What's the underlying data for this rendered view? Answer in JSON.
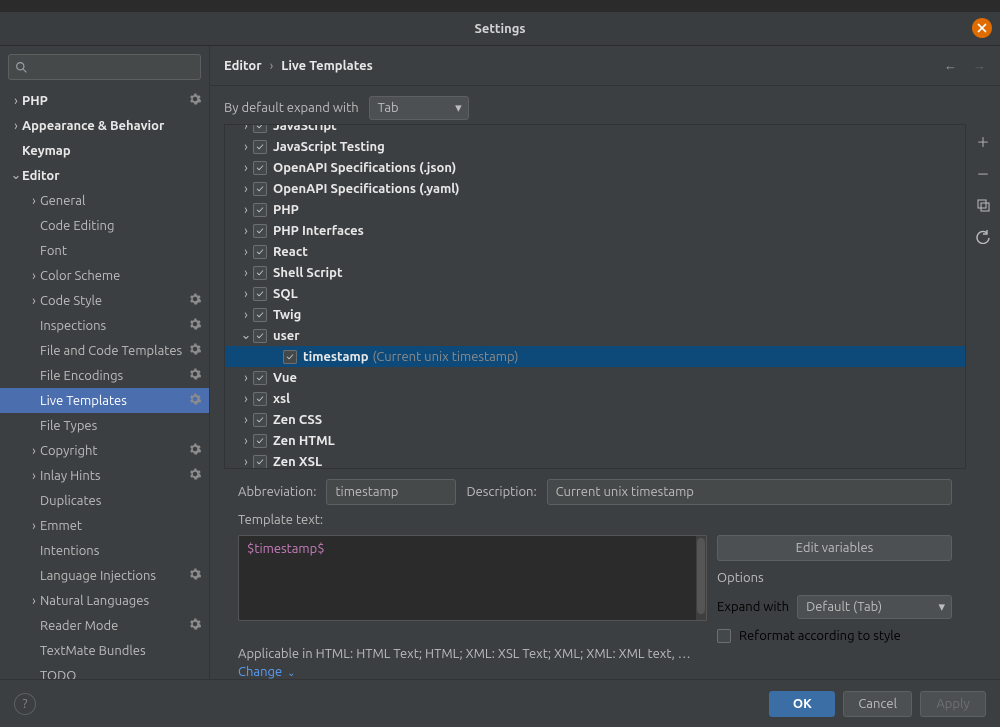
{
  "window": {
    "title": "Settings"
  },
  "search": {
    "placeholder": ""
  },
  "sidebar": {
    "items": [
      {
        "label": "PHP",
        "depth": 0,
        "arrow": "right",
        "bold": true,
        "gear": true
      },
      {
        "label": "Appearance & Behavior",
        "depth": 0,
        "arrow": "right",
        "bold": true
      },
      {
        "label": "Keymap",
        "depth": 0,
        "bold": true
      },
      {
        "label": "Editor",
        "depth": 0,
        "arrow": "down",
        "bold": true
      },
      {
        "label": "General",
        "depth": 1,
        "arrow": "right"
      },
      {
        "label": "Code Editing",
        "depth": 1
      },
      {
        "label": "Font",
        "depth": 1
      },
      {
        "label": "Color Scheme",
        "depth": 1,
        "arrow": "right"
      },
      {
        "label": "Code Style",
        "depth": 1,
        "arrow": "right",
        "gear": true
      },
      {
        "label": "Inspections",
        "depth": 1,
        "gear": true
      },
      {
        "label": "File and Code Templates",
        "depth": 1,
        "gear": true
      },
      {
        "label": "File Encodings",
        "depth": 1,
        "gear": true
      },
      {
        "label": "Live Templates",
        "depth": 1,
        "selected": true,
        "gear": true
      },
      {
        "label": "File Types",
        "depth": 1
      },
      {
        "label": "Copyright",
        "depth": 1,
        "arrow": "right",
        "gear": true
      },
      {
        "label": "Inlay Hints",
        "depth": 1,
        "arrow": "right",
        "gear": true
      },
      {
        "label": "Duplicates",
        "depth": 1
      },
      {
        "label": "Emmet",
        "depth": 1,
        "arrow": "right"
      },
      {
        "label": "Intentions",
        "depth": 1
      },
      {
        "label": "Language Injections",
        "depth": 1,
        "gear": true
      },
      {
        "label": "Natural Languages",
        "depth": 1,
        "arrow": "right"
      },
      {
        "label": "Reader Mode",
        "depth": 1,
        "gear": true
      },
      {
        "label": "TextMate Bundles",
        "depth": 1
      },
      {
        "label": "TODO",
        "depth": 1
      }
    ]
  },
  "breadcrumb": {
    "a": "Editor",
    "b": "Live Templates"
  },
  "expand": {
    "label": "By default expand with",
    "value": "Tab"
  },
  "groups": [
    {
      "label": "JavaScript",
      "arrow": "right",
      "checked": true,
      "cut": true
    },
    {
      "label": "JavaScript Testing",
      "arrow": "right",
      "checked": true
    },
    {
      "label": "OpenAPI Specifications (.json)",
      "arrow": "right",
      "checked": true
    },
    {
      "label": "OpenAPI Specifications (.yaml)",
      "arrow": "right",
      "checked": true
    },
    {
      "label": "PHP",
      "arrow": "right",
      "checked": true
    },
    {
      "label": "PHP Interfaces",
      "arrow": "right",
      "checked": true
    },
    {
      "label": "React",
      "arrow": "right",
      "checked": true
    },
    {
      "label": "Shell Script",
      "arrow": "right",
      "checked": true
    },
    {
      "label": "SQL",
      "arrow": "right",
      "checked": true
    },
    {
      "label": "Twig",
      "arrow": "right",
      "checked": true
    },
    {
      "label": "user",
      "arrow": "down",
      "checked": true,
      "children": [
        {
          "label": "timestamp",
          "desc": "(Current unix timestamp)",
          "checked": true,
          "selected": true
        }
      ]
    },
    {
      "label": "Vue",
      "arrow": "right",
      "checked": true
    },
    {
      "label": "xsl",
      "arrow": "right",
      "checked": true
    },
    {
      "label": "Zen CSS",
      "arrow": "right",
      "checked": true
    },
    {
      "label": "Zen HTML",
      "arrow": "right",
      "checked": true
    },
    {
      "label": "Zen XSL",
      "arrow": "right",
      "checked": true
    }
  ],
  "form": {
    "abbr_label": "Abbreviation:",
    "abbr_value": "timestamp",
    "desc_label": "Description:",
    "desc_value": "Current unix timestamp",
    "tt_label": "Template text:",
    "tt_value": "$timestamp$",
    "edit_vars": "Edit variables",
    "options": "Options",
    "expand_with_label": "Expand with",
    "expand_with_value": "Default (Tab)",
    "reformat": "Reformat according to style",
    "applicable": "Applicable in HTML: HTML Text; HTML; XML: XSL Text; XML; XML: XML text, …",
    "change": "Change"
  },
  "footer": {
    "ok": "OK",
    "cancel": "Cancel",
    "apply": "Apply"
  }
}
